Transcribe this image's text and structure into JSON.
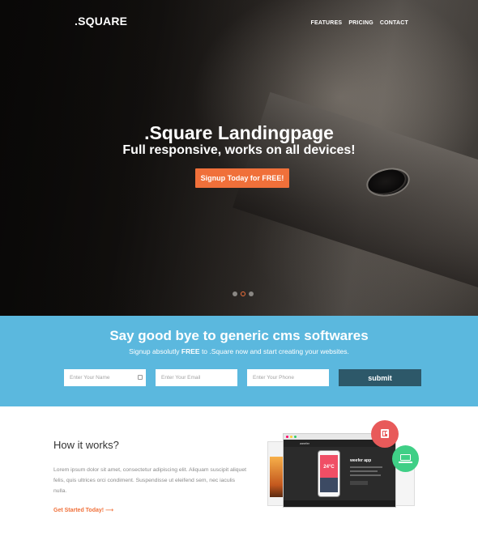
{
  "brand": ".SQUARE",
  "nav": {
    "features": "FEATURES",
    "pricing": "PRICING",
    "contact": "CONTACT"
  },
  "hero": {
    "title": ".Square Landingpage",
    "subtitle": "Full responsive, works on all devices!",
    "cta_label": "Signup Today for FREE!",
    "slide_count": 3,
    "active_slide": 2
  },
  "signup": {
    "title": "Say good bye to generic cms softwares",
    "subtitle_pre": "Signup absolutly ",
    "subtitle_bold": "FREE",
    "subtitle_post": " to .Square now and start creating your websites.",
    "name_placeholder": "Enter Your Name",
    "email_placeholder": "Enter Your Email",
    "phone_placeholder": "Enter Your Phone",
    "submit_label": "submit"
  },
  "how": {
    "title": "How it works?",
    "body": "Lorem ipsum dolor sit amet, consectetur adipiscing elit. Aliquam suscipit aliquet felis, quis ultrices orci condiment. Suspendisse ut eleifend sem, nec iaculis nulla.",
    "link_label": "Get Started Today! ⟶"
  },
  "mockup": {
    "app_name": "weefer app",
    "temperature": "24°C",
    "site_brand": "weefer"
  },
  "colors": {
    "accent": "#f0703a",
    "band": "#5bb8de",
    "submit": "#2d5869",
    "red_badge": "#e85a5a",
    "green_badge": "#3fcf86"
  },
  "icons": [
    "contact-card-icon",
    "trello-board-icon",
    "laptop-icon"
  ]
}
